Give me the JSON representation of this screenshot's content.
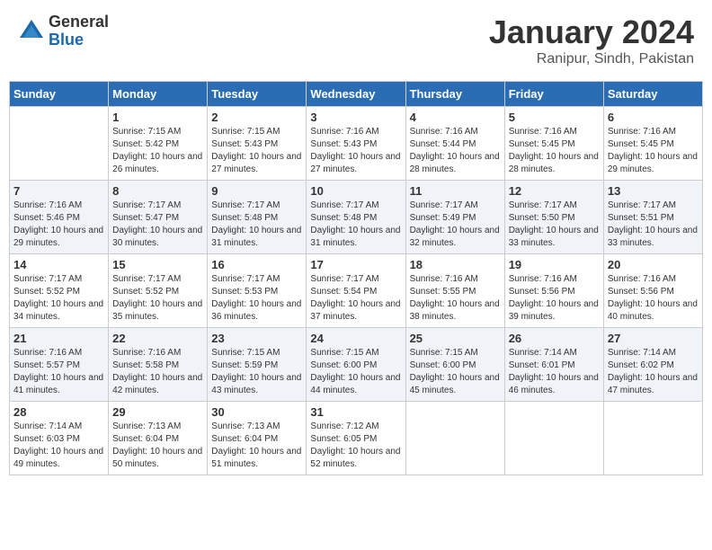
{
  "header": {
    "logo_general": "General",
    "logo_blue": "Blue",
    "month_title": "January 2024",
    "location": "Ranipur, Sindh, Pakistan"
  },
  "days_of_week": [
    "Sunday",
    "Monday",
    "Tuesday",
    "Wednesday",
    "Thursday",
    "Friday",
    "Saturday"
  ],
  "weeks": [
    [
      {
        "day": "",
        "info": ""
      },
      {
        "day": "1",
        "info": "Sunrise: 7:15 AM\nSunset: 5:42 PM\nDaylight: 10 hours\nand 26 minutes."
      },
      {
        "day": "2",
        "info": "Sunrise: 7:15 AM\nSunset: 5:43 PM\nDaylight: 10 hours\nand 27 minutes."
      },
      {
        "day": "3",
        "info": "Sunrise: 7:16 AM\nSunset: 5:43 PM\nDaylight: 10 hours\nand 27 minutes."
      },
      {
        "day": "4",
        "info": "Sunrise: 7:16 AM\nSunset: 5:44 PM\nDaylight: 10 hours\nand 28 minutes."
      },
      {
        "day": "5",
        "info": "Sunrise: 7:16 AM\nSunset: 5:45 PM\nDaylight: 10 hours\nand 28 minutes."
      },
      {
        "day": "6",
        "info": "Sunrise: 7:16 AM\nSunset: 5:45 PM\nDaylight: 10 hours\nand 29 minutes."
      }
    ],
    [
      {
        "day": "7",
        "info": "Sunrise: 7:16 AM\nSunset: 5:46 PM\nDaylight: 10 hours\nand 29 minutes."
      },
      {
        "day": "8",
        "info": "Sunrise: 7:17 AM\nSunset: 5:47 PM\nDaylight: 10 hours\nand 30 minutes."
      },
      {
        "day": "9",
        "info": "Sunrise: 7:17 AM\nSunset: 5:48 PM\nDaylight: 10 hours\nand 31 minutes."
      },
      {
        "day": "10",
        "info": "Sunrise: 7:17 AM\nSunset: 5:48 PM\nDaylight: 10 hours\nand 31 minutes."
      },
      {
        "day": "11",
        "info": "Sunrise: 7:17 AM\nSunset: 5:49 PM\nDaylight: 10 hours\nand 32 minutes."
      },
      {
        "day": "12",
        "info": "Sunrise: 7:17 AM\nSunset: 5:50 PM\nDaylight: 10 hours\nand 33 minutes."
      },
      {
        "day": "13",
        "info": "Sunrise: 7:17 AM\nSunset: 5:51 PM\nDaylight: 10 hours\nand 33 minutes."
      }
    ],
    [
      {
        "day": "14",
        "info": "Sunrise: 7:17 AM\nSunset: 5:52 PM\nDaylight: 10 hours\nand 34 minutes."
      },
      {
        "day": "15",
        "info": "Sunrise: 7:17 AM\nSunset: 5:52 PM\nDaylight: 10 hours\nand 35 minutes."
      },
      {
        "day": "16",
        "info": "Sunrise: 7:17 AM\nSunset: 5:53 PM\nDaylight: 10 hours\nand 36 minutes."
      },
      {
        "day": "17",
        "info": "Sunrise: 7:17 AM\nSunset: 5:54 PM\nDaylight: 10 hours\nand 37 minutes."
      },
      {
        "day": "18",
        "info": "Sunrise: 7:16 AM\nSunset: 5:55 PM\nDaylight: 10 hours\nand 38 minutes."
      },
      {
        "day": "19",
        "info": "Sunrise: 7:16 AM\nSunset: 5:56 PM\nDaylight: 10 hours\nand 39 minutes."
      },
      {
        "day": "20",
        "info": "Sunrise: 7:16 AM\nSunset: 5:56 PM\nDaylight: 10 hours\nand 40 minutes."
      }
    ],
    [
      {
        "day": "21",
        "info": "Sunrise: 7:16 AM\nSunset: 5:57 PM\nDaylight: 10 hours\nand 41 minutes."
      },
      {
        "day": "22",
        "info": "Sunrise: 7:16 AM\nSunset: 5:58 PM\nDaylight: 10 hours\nand 42 minutes."
      },
      {
        "day": "23",
        "info": "Sunrise: 7:15 AM\nSunset: 5:59 PM\nDaylight: 10 hours\nand 43 minutes."
      },
      {
        "day": "24",
        "info": "Sunrise: 7:15 AM\nSunset: 6:00 PM\nDaylight: 10 hours\nand 44 minutes."
      },
      {
        "day": "25",
        "info": "Sunrise: 7:15 AM\nSunset: 6:00 PM\nDaylight: 10 hours\nand 45 minutes."
      },
      {
        "day": "26",
        "info": "Sunrise: 7:14 AM\nSunset: 6:01 PM\nDaylight: 10 hours\nand 46 minutes."
      },
      {
        "day": "27",
        "info": "Sunrise: 7:14 AM\nSunset: 6:02 PM\nDaylight: 10 hours\nand 47 minutes."
      }
    ],
    [
      {
        "day": "28",
        "info": "Sunrise: 7:14 AM\nSunset: 6:03 PM\nDaylight: 10 hours\nand 49 minutes."
      },
      {
        "day": "29",
        "info": "Sunrise: 7:13 AM\nSunset: 6:04 PM\nDaylight: 10 hours\nand 50 minutes."
      },
      {
        "day": "30",
        "info": "Sunrise: 7:13 AM\nSunset: 6:04 PM\nDaylight: 10 hours\nand 51 minutes."
      },
      {
        "day": "31",
        "info": "Sunrise: 7:12 AM\nSunset: 6:05 PM\nDaylight: 10 hours\nand 52 minutes."
      },
      {
        "day": "",
        "info": ""
      },
      {
        "day": "",
        "info": ""
      },
      {
        "day": "",
        "info": ""
      }
    ]
  ]
}
